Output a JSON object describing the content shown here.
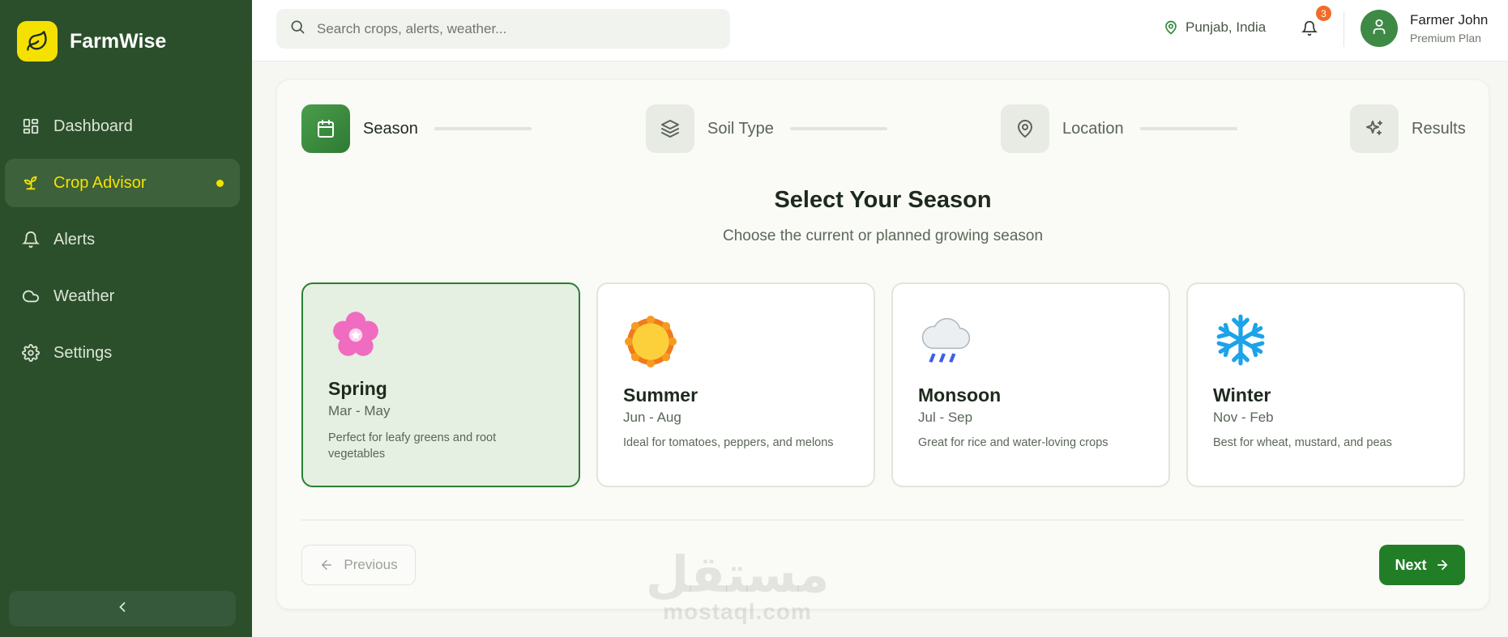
{
  "brand": {
    "name": "FarmWise",
    "logo_icon": "leaf-icon",
    "accent": "#f5e100"
  },
  "sidebar": {
    "items": [
      {
        "label": "Dashboard",
        "icon": "grid-icon",
        "active": false
      },
      {
        "label": "Crop Advisor",
        "icon": "sprout-icon",
        "active": true
      },
      {
        "label": "Alerts",
        "icon": "bell-icon",
        "active": false
      },
      {
        "label": "Weather",
        "icon": "cloud-icon",
        "active": false
      },
      {
        "label": "Settings",
        "icon": "gear-icon",
        "active": false
      }
    ],
    "collapse_icon": "chevron-left-icon",
    "bg_color": "#2b4f2b"
  },
  "header": {
    "search_placeholder": "Search crops, alerts, weather...",
    "location": "Punjab, India",
    "notification_count": "3",
    "user": {
      "name": "Farmer John",
      "plan": "Premium Plan"
    }
  },
  "wizard": {
    "steps": [
      {
        "label": "Season",
        "icon": "calendar-icon",
        "active": true
      },
      {
        "label": "Soil Type",
        "icon": "layers-icon",
        "active": false
      },
      {
        "label": "Location",
        "icon": "map-pin-icon",
        "active": false
      },
      {
        "label": "Results",
        "icon": "sparkles-icon",
        "active": false
      }
    ],
    "title": "Select Your Season",
    "subtitle": "Choose the current or planned growing season",
    "seasons": [
      {
        "name": "Spring",
        "months": "Mar - May",
        "description": "Perfect for leafy greens and root vegetables",
        "icon": "blossom-icon",
        "selected": true
      },
      {
        "name": "Summer",
        "months": "Jun - Aug",
        "description": "Ideal for tomatoes, peppers, and melons",
        "icon": "sun-icon",
        "selected": false
      },
      {
        "name": "Monsoon",
        "months": "Jul - Sep",
        "description": "Great for rice and water-loving crops",
        "icon": "rain-cloud-icon",
        "selected": false
      },
      {
        "name": "Winter",
        "months": "Nov - Feb",
        "description": "Best for wheat, mustard, and peas",
        "icon": "snowflake-icon",
        "selected": false
      }
    ],
    "prev_label": "Previous",
    "next_label": "Next",
    "primary_color": "#217e27"
  },
  "watermark": {
    "arabic": "مستقل",
    "latin": "mostaql.com"
  }
}
